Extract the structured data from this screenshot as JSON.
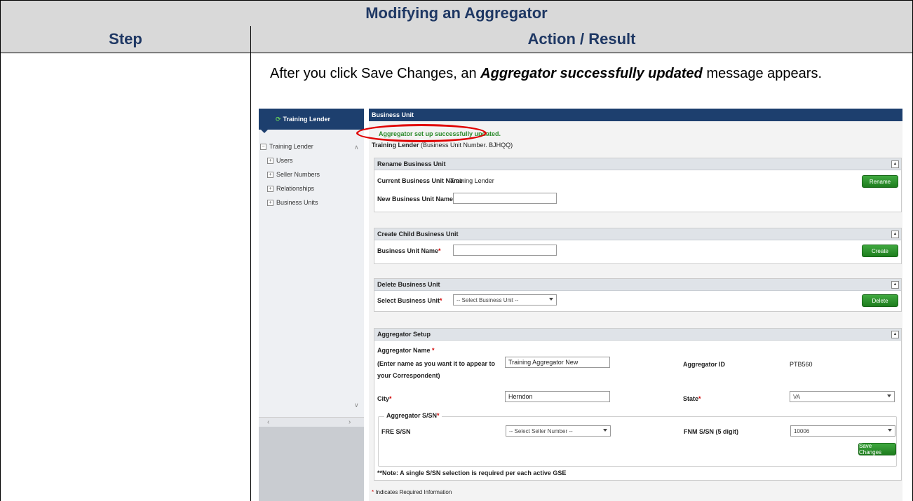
{
  "table": {
    "title": "Modifying an Aggregator",
    "col_step": "Step",
    "col_action": "Action / Result"
  },
  "instruction": {
    "before": "After you click Save Changes, an ",
    "emphasis": "Aggregator successfully updated",
    "after": " message appears."
  },
  "app": {
    "left_header": "Training Lender",
    "tree": {
      "root": "Training Lender",
      "children": [
        "Users",
        "Seller Numbers",
        "Relationships",
        "Business Units"
      ]
    },
    "main_header": "Business Unit",
    "success_message": "Aggregator set up successfully updated.",
    "bu_name": "Training Lender",
    "bu_number_text": "(Business Unit Number. BJHQQ)",
    "rename": {
      "title": "Rename Business Unit",
      "current_label": "Current Business Unit Name",
      "current_value": "Training Lender",
      "new_label": "New Business Unit Name",
      "new_value": "",
      "button": "Rename"
    },
    "create": {
      "title": "Create Child Business Unit",
      "name_label": "Business Unit Name",
      "name_value": "",
      "button": "Create"
    },
    "delete": {
      "title": "Delete Business Unit",
      "select_label": "Select Business Unit",
      "select_value": "-- Select Business Unit --",
      "button": "Delete"
    },
    "aggregator": {
      "title": "Aggregator Setup",
      "name_label": "Aggregator Name",
      "name_hint": "(Enter name as you want it to appear to your Correspondent)",
      "name_value": "Training Aggregator New",
      "id_label": "Aggregator ID",
      "id_value": "PTB560",
      "city_label": "City",
      "city_value": "Herndon",
      "state_label": "State",
      "state_value": "VA",
      "ssn_legend": "Aggregator S/SN",
      "fre_label": "FRE S/SN",
      "fre_value": "-- Select Seller Number --",
      "fnm_label": "FNM S/SN (5 digit)",
      "fnm_value": "10006",
      "save_button": "Save Changes",
      "note": "**Note: A single S/SN selection is required per each active GSE"
    },
    "required_note": "Indicates Required Information"
  }
}
